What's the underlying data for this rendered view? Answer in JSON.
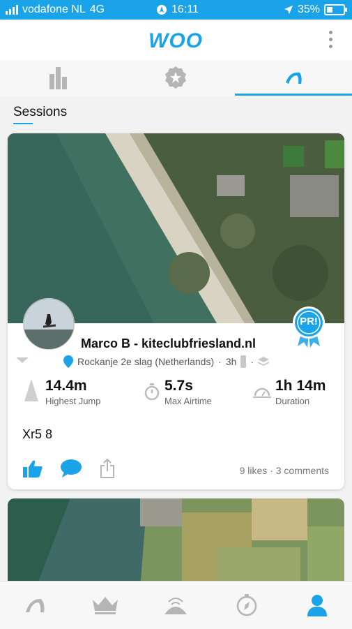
{
  "status_bar": {
    "carrier": "vodafone NL",
    "network": "4G",
    "time": "16:11",
    "battery": "35%"
  },
  "header": {
    "logo_text": "WOO",
    "menu_icon": "more-vertical-icon"
  },
  "tabs": [
    {
      "name": "stats",
      "icon": "bar-chart-icon",
      "active": false
    },
    {
      "name": "badges",
      "icon": "award-icon",
      "active": false
    },
    {
      "name": "sessions",
      "icon": "kite-icon",
      "active": true
    }
  ],
  "section": {
    "title": "Sessions"
  },
  "session": {
    "user_name": "Marco B - kiteclubfriesland.nl",
    "location": "Rockanje 2e slag (Netherlands)",
    "age": "3h",
    "badge_text": "PR!",
    "stats": [
      {
        "value": "14.4m",
        "label": "Highest Jump",
        "icon": "jump-icon"
      },
      {
        "value": "5.7s",
        "label": "Max Airtime",
        "icon": "stopwatch-icon"
      },
      {
        "value": "1h 14m",
        "label": "Duration",
        "icon": "duration-icon"
      }
    ],
    "kite_text": "Xr5 8",
    "likes": "9 likes",
    "comments": "3 comments",
    "separator": "·"
  },
  "bottom_nav": [
    {
      "name": "kite",
      "icon": "kite-icon"
    },
    {
      "name": "leaderboard",
      "icon": "crown-icon"
    },
    {
      "name": "spots",
      "icon": "spot-icon"
    },
    {
      "name": "explore",
      "icon": "compass-icon"
    },
    {
      "name": "profile",
      "icon": "user-icon",
      "active": true
    }
  ],
  "colors": {
    "accent": "#1aa3e8",
    "inactive_icon": "#b5b5b5"
  }
}
